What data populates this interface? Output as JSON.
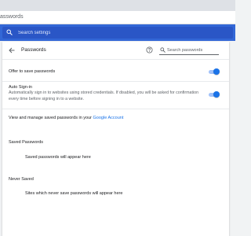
{
  "browser": {
    "address_text": "asswords"
  },
  "settings_search": {
    "placeholder": "Search settings"
  },
  "page": {
    "title": "Passwords",
    "search_placeholder": "Search passwords"
  },
  "offer_to_save": {
    "label": "Offer to save passwords",
    "enabled": true
  },
  "auto_signin": {
    "label": "Auto Sign-in",
    "description": "Automatically sign in to websites using stored credentials. If disabled, you will be asked for confirmation every time before signing in to a website.",
    "enabled": true
  },
  "google_account": {
    "prefix": "View and manage saved passwords in your ",
    "link_text": "Google Account"
  },
  "saved_passwords": {
    "title": "Saved Passwords",
    "empty_text": "Saved passwords will appear here"
  },
  "never_saved": {
    "title": "Never Saved",
    "empty_text": "Sites which never save passwords will appear here"
  },
  "colors": {
    "header_blue": "#3367d6",
    "toggle_on": "#1a73e8",
    "link": "#1a73e8"
  },
  "icons": {
    "settings_search": "search-icon",
    "back": "arrow-back-icon",
    "help": "help-circle-icon",
    "password_search": "search-icon"
  }
}
